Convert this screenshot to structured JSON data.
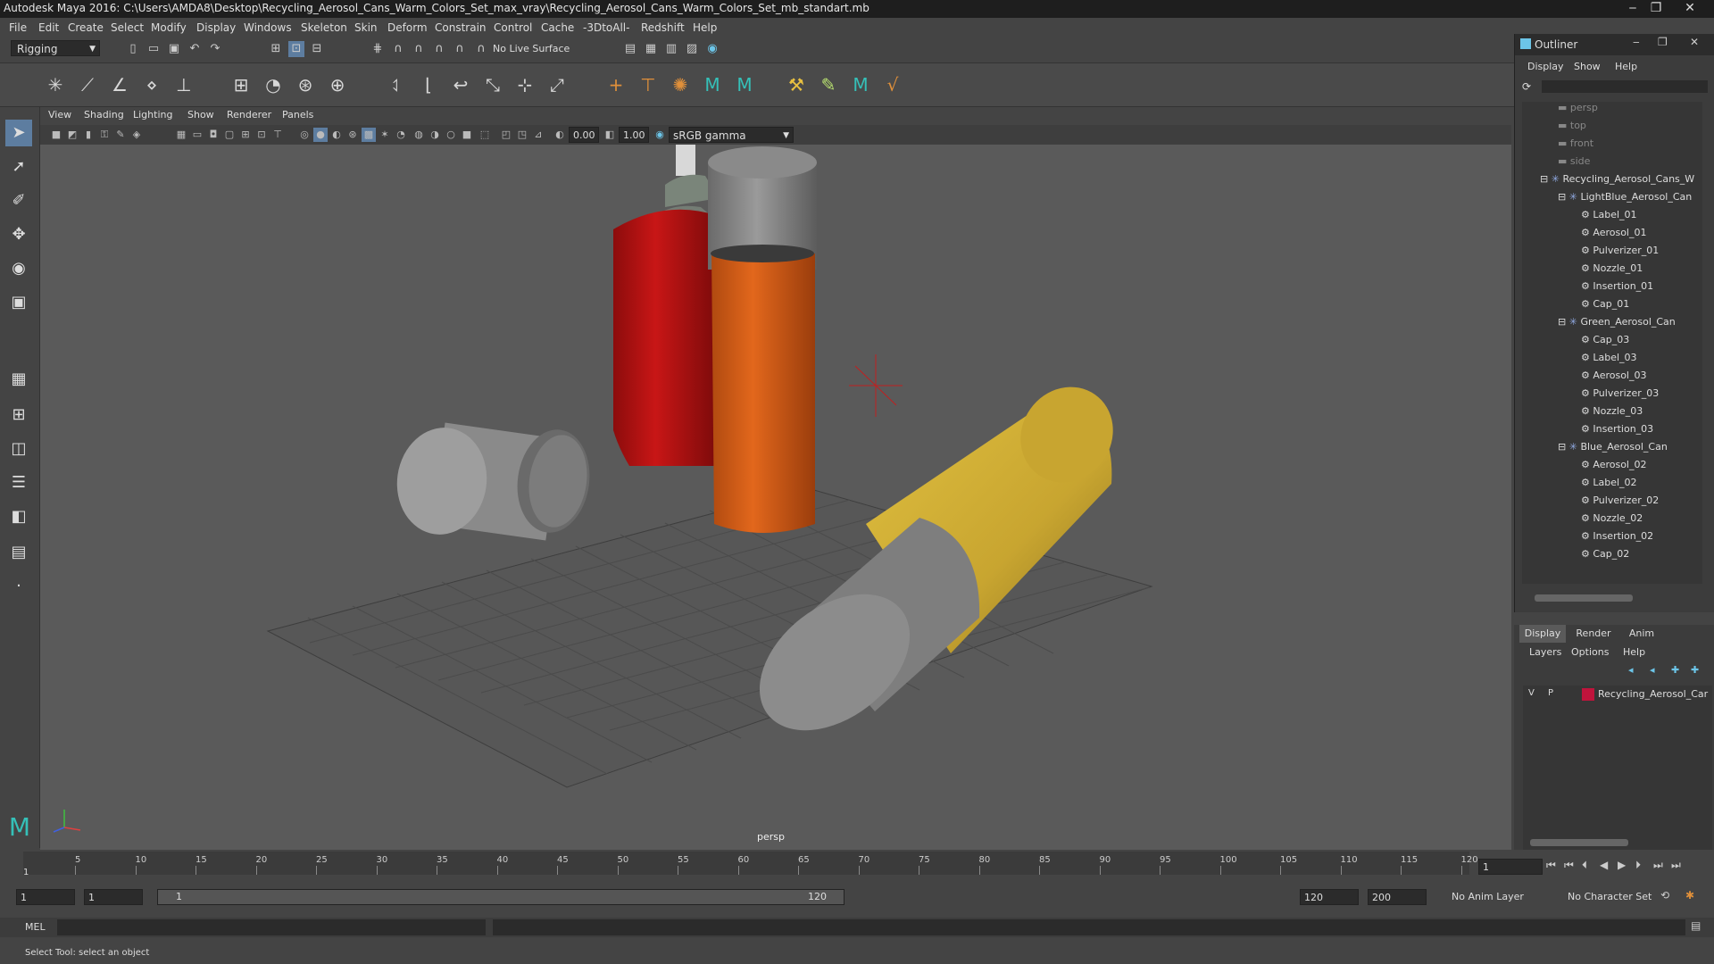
{
  "window": {
    "title": "Autodesk Maya 2016: C:\\Users\\AMDA8\\Desktop\\Recycling_Aerosol_Cans_Warm_Colors_Set_max_vray\\Recycling_Aerosol_Cans_Warm_Colors_Set_mb_standart.mb",
    "minimize": "‒",
    "maximize": "❐",
    "close": "✕"
  },
  "menubar": [
    "File",
    "Edit",
    "Create",
    "Select",
    "Modify",
    "Display",
    "Windows",
    "Skeleton",
    "Skin",
    "Deform",
    "Constrain",
    "Control",
    "Cache",
    "-3DtoAll-",
    "Redshift",
    "Help"
  ],
  "statusline": {
    "mode": "Rigging",
    "live_surface": "No Live Surface"
  },
  "viewport": {
    "menu": [
      "View",
      "Shading",
      "Lighting",
      "Show",
      "Renderer",
      "Panels"
    ],
    "exposure": "0.00",
    "gamma": "1.00",
    "color_space": "sRGB gamma",
    "camera_label": "persp"
  },
  "outliner": {
    "title": "Outliner",
    "menu": [
      "Display",
      "Show",
      "Help"
    ],
    "cameras": [
      "persp",
      "top",
      "front",
      "side"
    ],
    "root": "Recycling_Aerosol_Cans_W",
    "groups": [
      {
        "name": "LightBlue_Aerosol_Can",
        "children": [
          "Label_01",
          "Aerosol_01",
          "Pulverizer_01",
          "Nozzle_01",
          "Insertion_01",
          "Cap_01"
        ]
      },
      {
        "name": "Green_Aerosol_Can",
        "children": [
          "Cap_03",
          "Label_03",
          "Aerosol_03",
          "Pulverizer_03",
          "Nozzle_03",
          "Insertion_03"
        ]
      },
      {
        "name": "Blue_Aerosol_Can",
        "children": [
          "Aerosol_02",
          "Label_02",
          "Pulverizer_02",
          "Nozzle_02",
          "Insertion_02",
          "Cap_02"
        ]
      }
    ]
  },
  "layers": {
    "tabs": [
      "Display",
      "Render",
      "Anim"
    ],
    "menu": [
      "Layers",
      "Options",
      "Help"
    ],
    "layer": {
      "v": "V",
      "p": "P",
      "name": "Recycling_Aerosol_Car",
      "color": "#c0143c"
    }
  },
  "timeline": {
    "ticks": [
      "5",
      "10",
      "15",
      "20",
      "25",
      "30",
      "35",
      "40",
      "45",
      "50",
      "55",
      "60",
      "65",
      "70",
      "75",
      "80",
      "85",
      "90",
      "95",
      "100",
      "105",
      "110",
      "115",
      "120"
    ],
    "start_marker": "1",
    "current_frame": "1",
    "range_start": "1",
    "range_start2": "1",
    "range_inner_start": "1",
    "range_inner_end": "120",
    "range_end": "120",
    "range_max": "200",
    "anim_layer": "No Anim Layer",
    "character_set": "No Character Set"
  },
  "cmdline": {
    "label": "MEL"
  },
  "helpline": {
    "text": "Select Tool: select an object"
  }
}
